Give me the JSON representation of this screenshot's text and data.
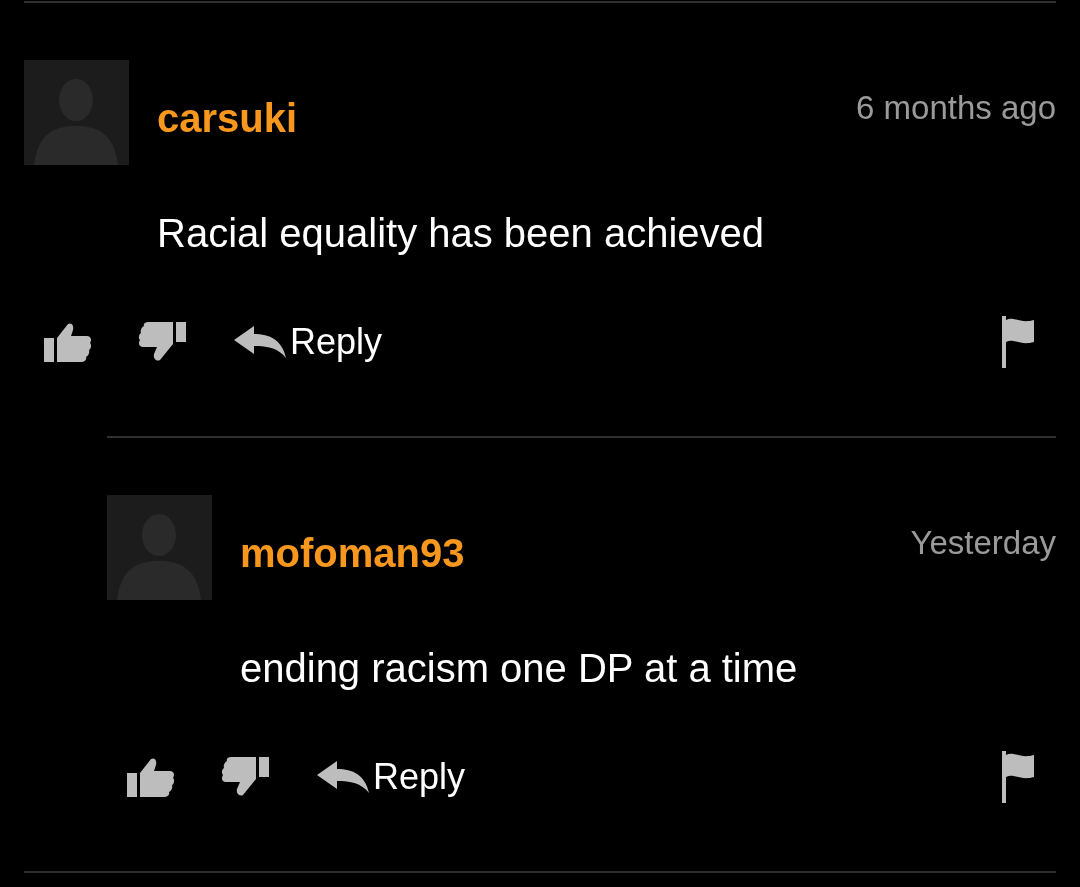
{
  "comments": [
    {
      "username": "carsuki",
      "time": "6 months ago",
      "body": "Racial equality has been achieved",
      "reply_label": "Reply",
      "children": [
        {
          "username": "mofoman93",
          "time": "Yesterday",
          "body": "ending racism one DP at a time",
          "reply_label": "Reply"
        }
      ]
    }
  ]
}
